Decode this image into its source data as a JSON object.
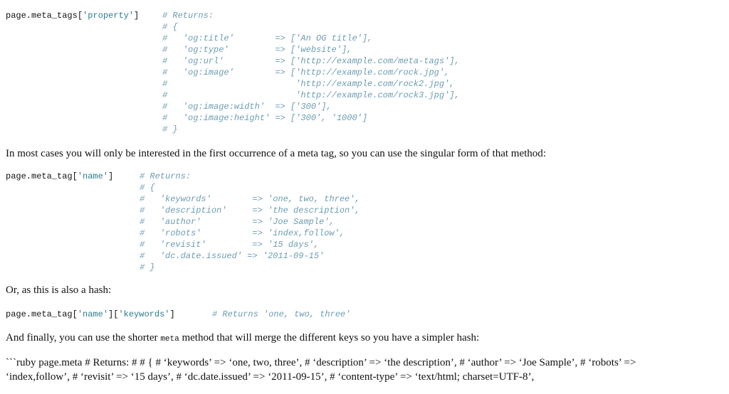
{
  "block1": {
    "code_prefix": "page.meta_tags[",
    "code_string": "'property'",
    "code_suffix": "]",
    "comment": "# Returns:\n# {\n#   'og:title'        => ['An OG title'],\n#   'og:type'         => ['website'],\n#   'og:url'          => ['http://example.com/meta-tags'],\n#   'og:image'        => ['http://example.com/rock.jpg',\n#                         'http://example.com/rock2.jpg',\n#                         'http://example.com/rock3.jpg'],\n#   'og:image:width'  => ['300'],\n#   'og:image:height' => ['300', '1000']\n# }"
  },
  "para1": "In most cases you will only be interested in the first occurrence of a meta tag, so you can use the singular form of that method:",
  "block2": {
    "code_prefix": "page.meta_tag[",
    "code_string": "'name'",
    "code_suffix": "]",
    "comment": "# Returns:\n# {\n#   'keywords'        => 'one, two, three',\n#   'description'     => 'the description',\n#   'author'          => 'Joe Sample',\n#   'robots'          => 'index,follow',\n#   'revisit'         => '15 days',\n#   'dc.date.issued' => '2011-09-15'\n# }"
  },
  "para2": "Or, as this is also a hash:",
  "block3": {
    "code_prefix": "page.meta_tag[",
    "code_string1": "'name'",
    "code_mid": "][",
    "code_string2": "'keywords'",
    "code_suffix": "]",
    "comment": "# Returns 'one, two, three'"
  },
  "para3": {
    "before": "And finally, you can use the shorter ",
    "code": "meta",
    "after": " method that will merge the different keys so you have a simpler hash:"
  },
  "para4": "```ruby page.meta # Returns: # # { # ‘keywords’ => ‘one, two, three’, # ‘description’ => ‘the description’, # ‘author’ => ‘Joe Sample’, # ‘robots’ => ‘index,follow’, # ‘revisit’ => ‘15 days’, # ‘dc.date.issued’ => ‘2011-09-15’, # ‘content-type’ => ‘text/html; charset=UTF-8’,"
}
